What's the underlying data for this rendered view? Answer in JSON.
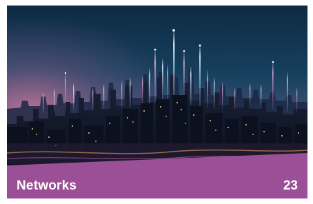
{
  "card": {
    "title": "Networks",
    "count": "23",
    "band_color": "#9b4f96",
    "image_subject": "city-skyline-network-lights"
  }
}
